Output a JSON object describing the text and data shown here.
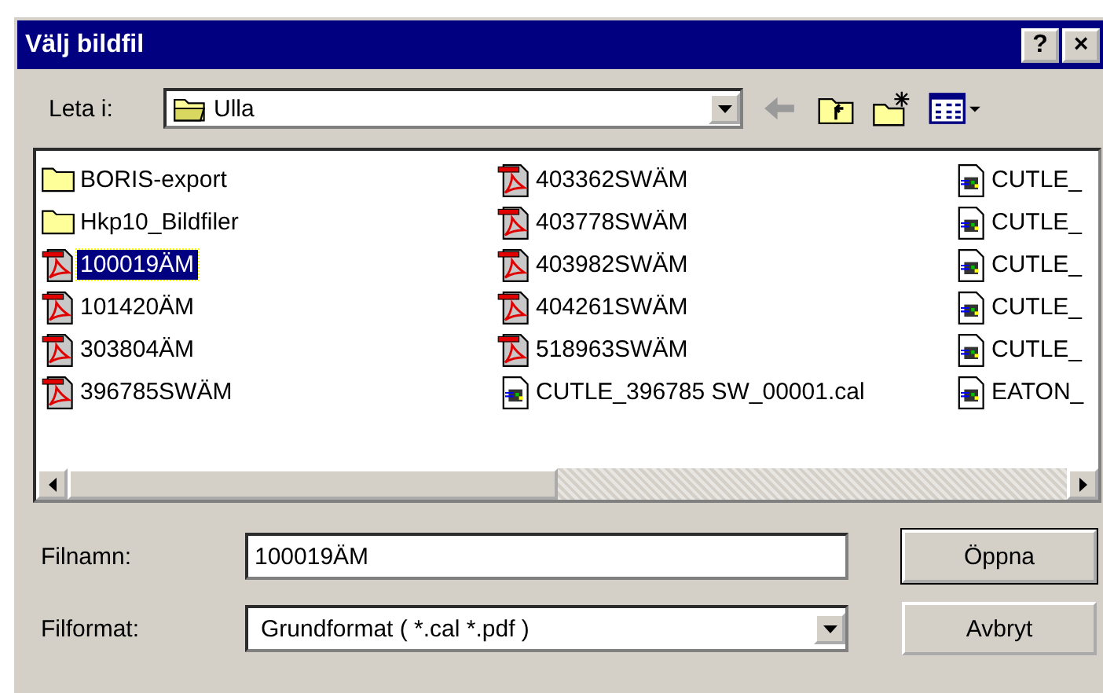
{
  "window": {
    "title": "Välj bildfil",
    "help_button": "?",
    "close_button": "×"
  },
  "look_in": {
    "label": "Leta i:",
    "value": "Ulla"
  },
  "files": [
    {
      "name": "BORIS-export",
      "kind": "folder",
      "selected": false
    },
    {
      "name": "Hkp10_Bildfiler",
      "kind": "folder",
      "selected": false
    },
    {
      "name": "100019ÄM",
      "kind": "pdf",
      "selected": true
    },
    {
      "name": "101420ÄM",
      "kind": "pdf",
      "selected": false
    },
    {
      "name": "303804ÄM",
      "kind": "pdf",
      "selected": false
    },
    {
      "name": "396785SWÄM",
      "kind": "pdf",
      "selected": false
    },
    {
      "name": "403362SWÄM",
      "kind": "pdf",
      "selected": false
    },
    {
      "name": "403778SWÄM",
      "kind": "pdf",
      "selected": false
    },
    {
      "name": "403982SWÄM",
      "kind": "pdf",
      "selected": false
    },
    {
      "name": "404261SWÄM",
      "kind": "pdf",
      "selected": false
    },
    {
      "name": "518963SWÄM",
      "kind": "pdf",
      "selected": false
    },
    {
      "name": "CUTLE_396785 SW_00001.cal",
      "kind": "cal",
      "selected": false
    },
    {
      "name": "CUTLE_",
      "kind": "cal",
      "selected": false
    },
    {
      "name": "CUTLE_",
      "kind": "cal",
      "selected": false
    },
    {
      "name": "CUTLE_",
      "kind": "cal",
      "selected": false
    },
    {
      "name": "CUTLE_",
      "kind": "cal",
      "selected": false
    },
    {
      "name": "CUTLE_",
      "kind": "cal",
      "selected": false
    },
    {
      "name": "EATON_",
      "kind": "cal",
      "selected": false
    }
  ],
  "filename": {
    "label": "Filnamn:",
    "value": "100019ÄM"
  },
  "filetype": {
    "label": "Filformat:",
    "value": "Grundformat ( *.cal *.pdf )"
  },
  "buttons": [
    {
      "label": "Öppna",
      "default": true
    },
    {
      "label": "Avbryt",
      "default": false
    }
  ]
}
